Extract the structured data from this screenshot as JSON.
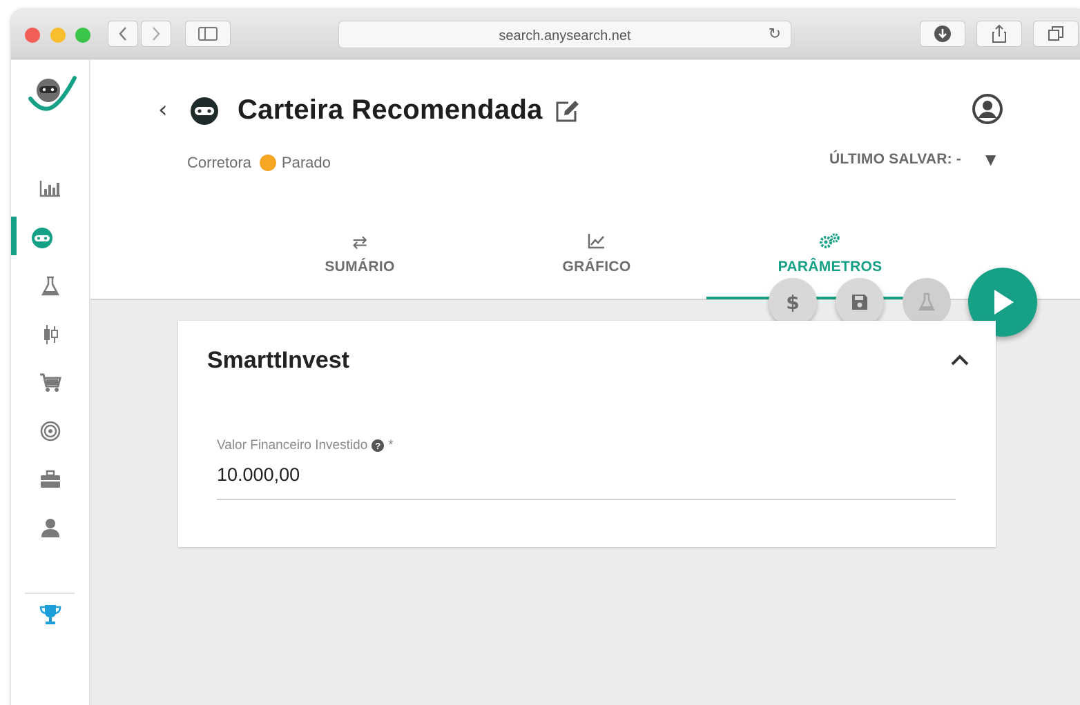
{
  "browser": {
    "url": "search.anysearch.net",
    "back_icon": "chevron-left-icon",
    "forward_icon": "chevron-right-icon",
    "sidebar_toggle_icon": "sidebar-icon",
    "reload_icon": "reload-icon",
    "download_icon": "download-icon",
    "share_icon": "share-icon",
    "tabs_icon": "tabs-icon"
  },
  "sidebar": {
    "items": [
      {
        "icon": "chart-icon",
        "active": false
      },
      {
        "icon": "robot-icon",
        "active": true
      },
      {
        "icon": "flask-icon",
        "active": false
      },
      {
        "icon": "candlestick-icon",
        "active": false
      },
      {
        "icon": "cart-icon",
        "active": false
      },
      {
        "icon": "target-icon",
        "active": false
      },
      {
        "icon": "briefcase-icon",
        "active": false
      },
      {
        "icon": "user-icon",
        "active": false
      }
    ],
    "bottom_item": {
      "icon": "trophy-icon"
    },
    "accent_color": "#16a085"
  },
  "header": {
    "title": "Carteira Recomendada",
    "broker": "Corretora",
    "status": "Parado",
    "status_color": "#f5a623",
    "last_save": "ÚLTIMO SALVAR: -"
  },
  "tabs": [
    {
      "label": "SUMÁRIO",
      "icon": "swap-icon",
      "active": false
    },
    {
      "label": "GRÁFICO",
      "icon": "line-chart-icon",
      "active": false
    },
    {
      "label": "PARÂMETROS",
      "icon": "gears-icon",
      "active": true
    }
  ],
  "actions": {
    "dollar_label": "$",
    "save_icon": "save-icon",
    "backtest_icon": "flask-icon",
    "run_icon": "play-icon"
  },
  "card": {
    "title": "SmarttInvest",
    "field": {
      "label": "Valor Financeiro Investido",
      "required_mark": "*",
      "help": "?",
      "value": "10.000,00"
    }
  }
}
